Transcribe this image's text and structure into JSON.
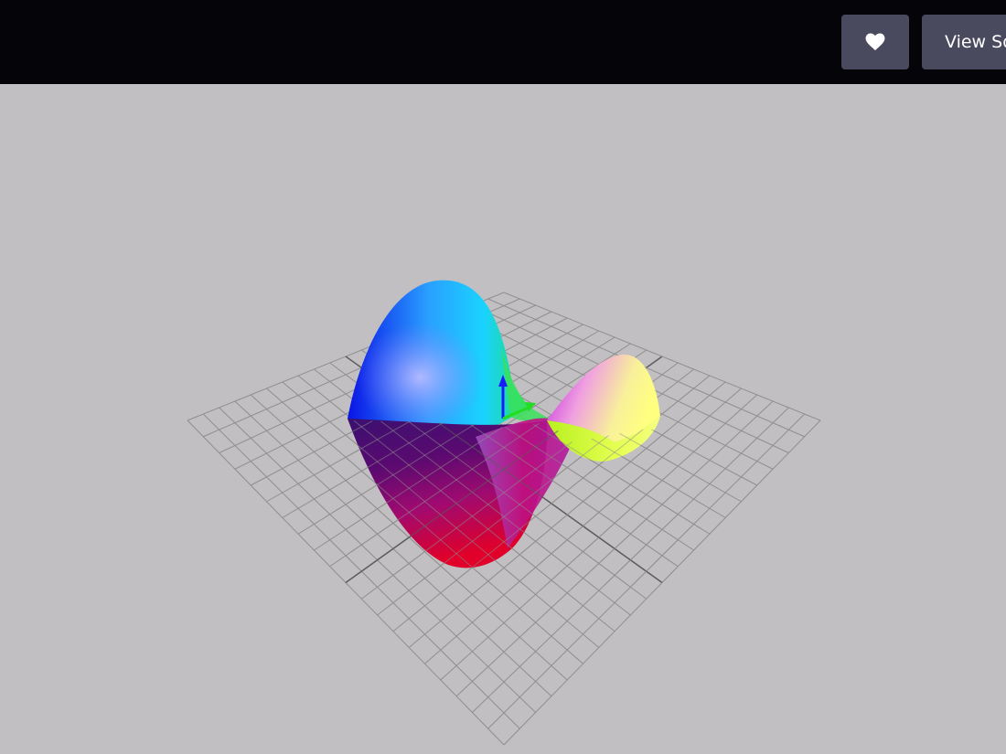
{
  "toolbar": {
    "like_icon": "heart-icon",
    "view_source_label": "View Source"
  },
  "colors": {
    "topbar": "#050409",
    "button": "#4a4a5e",
    "canvas_background": "#c1bfc1",
    "grid_lines": "#8f8f8f",
    "axis_lines": "#5a5a5a",
    "y_axis_arrow": "#1a1aff",
    "x_axis_arrow": "#22dd22"
  },
  "scene": {
    "object": "saddle-surface",
    "grid_divisions": 20,
    "axes": [
      "x",
      "y",
      "z"
    ]
  }
}
